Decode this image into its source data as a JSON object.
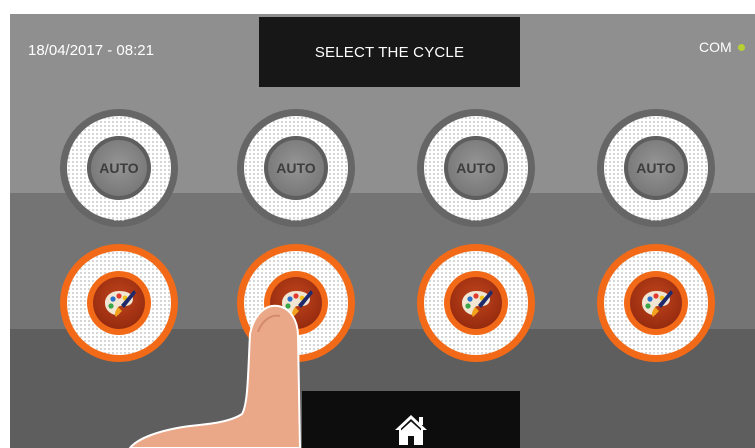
{
  "header": {
    "datetime": "18/04/2017 - 08:21",
    "title": "SELECT THE CYCLE",
    "com_label": "COM",
    "com_status_color": "#b6d232"
  },
  "cycles_row1": [
    {
      "icon": "auto-icon",
      "text": "AUTO",
      "label": "---"
    },
    {
      "icon": "auto-icon",
      "text": "AUTO",
      "label": "---"
    },
    {
      "icon": "auto-icon",
      "text": "AUTO",
      "label": "---"
    },
    {
      "icon": "auto-icon",
      "text": "AUTO",
      "label": "---"
    }
  ],
  "cycles_row2": [
    {
      "icon": "palette-brush-icon",
      "label": "---"
    },
    {
      "icon": "palette-brush-icon",
      "label": "---"
    },
    {
      "icon": "palette-brush-icon",
      "label": "---"
    },
    {
      "icon": "palette-brush-icon",
      "label": "---"
    }
  ],
  "footer": {
    "home_icon": "home-icon"
  },
  "colors": {
    "accent": "#f26a17",
    "band_top": "#8f8f8f",
    "band_mid": "#747474",
    "band_bottom": "#5e5e5e"
  }
}
